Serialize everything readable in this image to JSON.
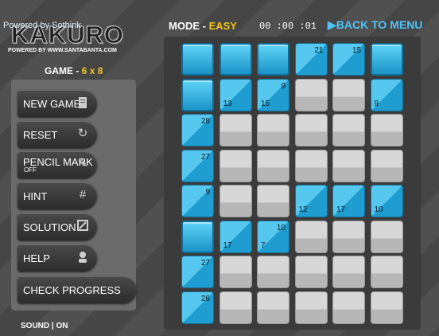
{
  "powered_by": "Powered by Sothink",
  "logo": {
    "title": "KAKURO",
    "subtitle": "POWERED BY WWW.SANTABANTA.COM"
  },
  "game": {
    "label": "GAME - ",
    "size": "6 x 8"
  },
  "buttons": {
    "new_game": "NEW GAME",
    "reset": "RESET",
    "pencil_mark": "PENCIL MARK",
    "pencil_state": "OFF",
    "hint": "HINT",
    "solution": "SOLUTION",
    "help": "HELP",
    "check_progress": "CHECK PROGRESS"
  },
  "sound": "SOUND | ON",
  "mode": {
    "label": "MODE - ",
    "value": "EASY"
  },
  "timer": "00 :00 :01",
  "back": "BACK TO MENU",
  "grid": {
    "cols": 6,
    "rows": 8,
    "cells": [
      [
        {
          "t": "b"
        },
        {
          "t": "b"
        },
        {
          "t": "b"
        },
        {
          "t": "c",
          "r": "21"
        },
        {
          "t": "c",
          "r": "15"
        },
        {
          "t": "b"
        }
      ],
      [
        {
          "t": "b"
        },
        {
          "t": "c",
          "d": "13"
        },
        {
          "t": "c",
          "r": "9",
          "d": "15"
        },
        {
          "t": "w"
        },
        {
          "t": "w"
        },
        {
          "t": "c",
          "d": "9"
        }
      ],
      [
        {
          "t": "c",
          "r": "28"
        },
        {
          "t": "w"
        },
        {
          "t": "w"
        },
        {
          "t": "w"
        },
        {
          "t": "w"
        },
        {
          "t": "w"
        }
      ],
      [
        {
          "t": "c",
          "r": "27"
        },
        {
          "t": "w"
        },
        {
          "t": "w"
        },
        {
          "t": "w"
        },
        {
          "t": "w"
        },
        {
          "t": "w"
        }
      ],
      [
        {
          "t": "c",
          "r": "9"
        },
        {
          "t": "w"
        },
        {
          "t": "w"
        },
        {
          "t": "c",
          "d": "12"
        },
        {
          "t": "c",
          "d": "17"
        },
        {
          "t": "c",
          "d": "10"
        }
      ],
      [
        {
          "t": "b"
        },
        {
          "t": "c",
          "d": "17"
        },
        {
          "t": "c",
          "r": "10",
          "d": "7"
        },
        {
          "t": "w"
        },
        {
          "t": "w"
        },
        {
          "t": "w"
        }
      ],
      [
        {
          "t": "c",
          "r": "27"
        },
        {
          "t": "w"
        },
        {
          "t": "w"
        },
        {
          "t": "w"
        },
        {
          "t": "w"
        },
        {
          "t": "w"
        }
      ],
      [
        {
          "t": "c",
          "r": "26"
        },
        {
          "t": "w"
        },
        {
          "t": "w"
        },
        {
          "t": "w"
        },
        {
          "t": "w"
        },
        {
          "t": "w"
        }
      ]
    ]
  }
}
